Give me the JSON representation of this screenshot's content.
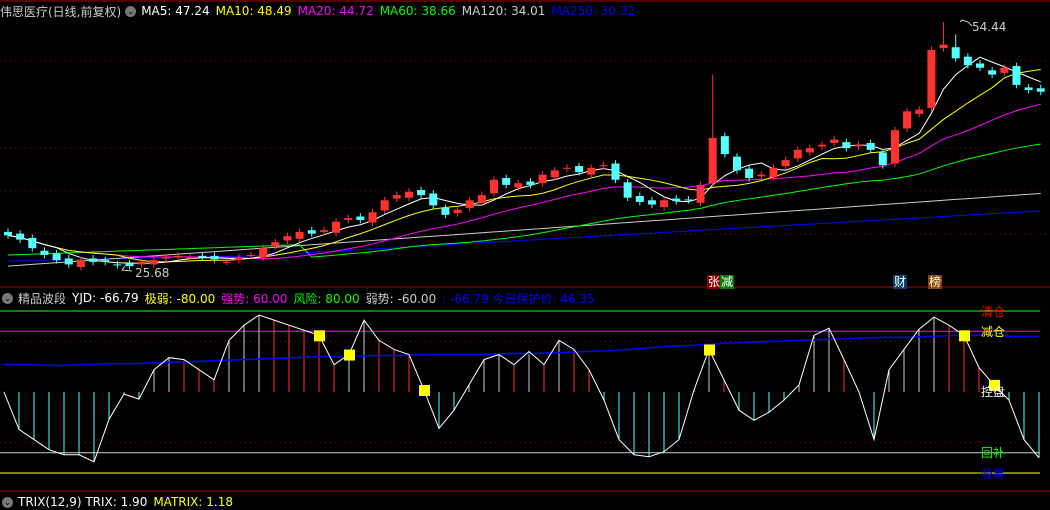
{
  "header": {
    "title": "伟思医疗(日线,前复权)",
    "ma": [
      {
        "label": "MA5: 47.24",
        "color": "#ffffff"
      },
      {
        "label": "MA10: 48.49",
        "color": "#ffff00"
      },
      {
        "label": "MA20: 44.72",
        "color": "#ff00ff"
      },
      {
        "label": "MA60: 38.66",
        "color": "#00ff00"
      },
      {
        "label": "MA120: 34.01",
        "color": "#cccccc"
      },
      {
        "label": "MA250: 30.32",
        "color": "#0000ff"
      }
    ]
  },
  "price": {
    "high_label": "54.44",
    "low_label": "25.68",
    "high": 54.44,
    "low": 25.68,
    "closes": [
      29.5,
      29.0,
      28.0,
      27.2,
      26.6,
      26.1,
      26.6,
      26.4,
      26.4,
      26.0,
      25.9,
      26.4,
      26.6,
      26.9,
      27.1,
      26.9,
      26.9,
      26.7,
      26.4,
      26.9,
      27.2,
      28.0,
      28.7,
      29.4,
      29.9,
      29.7,
      30.1,
      31.1,
      31.5,
      31.3,
      32.2,
      33.6,
      34.2,
      34.6,
      34.2,
      33.0,
      31.9,
      32.5,
      33.6,
      34.2,
      36.0,
      35.4,
      35.6,
      35.4,
      36.6,
      37.1,
      37.4,
      36.9,
      37.4,
      37.7,
      36.0,
      33.9,
      33.4,
      33.1,
      33.6,
      33.5,
      33.6,
      35.4,
      40.9,
      39.0,
      37.1,
      36.2,
      36.6,
      37.4,
      38.3,
      39.5,
      39.7,
      40.1,
      40.7,
      39.7,
      40.1,
      39.5,
      37.7,
      41.8,
      44.0,
      44.2,
      51.2,
      51.8,
      50.2,
      49.4,
      49.1,
      48.3,
      49.1,
      47.1,
      46.5,
      46.3
    ],
    "spikes": {
      "58": 48.3,
      "77": 54.44,
      "78": 53.0
    }
  },
  "tags": [
    {
      "text": "张",
      "bg": "#8b0000"
    },
    {
      "text": "减",
      "bg": "#008000"
    },
    {
      "text": "财",
      "bg": "#0a3a6e"
    },
    {
      "text": "榜",
      "bg": "#8b4500"
    }
  ],
  "indicator": {
    "name": "精品波段",
    "items": [
      {
        "label": "YJD: -66.79",
        "color": "#ffffff"
      },
      {
        "label": "极弱: -80.00",
        "color": "#ffff00"
      },
      {
        "label": "强势: 60.00",
        "color": "#ff00ff"
      },
      {
        "label": "风险: 80.00",
        "color": "#00ff00"
      },
      {
        "label": "弱势: -60.00",
        "color": "#cccccc"
      },
      {
        "label": ": -66.79  今日保护价: 46.35",
        "color": "#0000ff"
      }
    ],
    "levels": {
      "qingcang": "清仓",
      "jiancang": "减仓",
      "kongpan": "控盘",
      "huibu": "回补",
      "xichou": "吸筹"
    },
    "yjd": [
      0,
      -37,
      -47,
      -57,
      -62,
      -62,
      -69,
      -27,
      -2,
      -7,
      22,
      34,
      32,
      22,
      12,
      51,
      66,
      76,
      71,
      66,
      61,
      56,
      27,
      37,
      71,
      51,
      42,
      37,
      2,
      -36,
      -18,
      7,
      32,
      37,
      27,
      40,
      27,
      51,
      42,
      22,
      -8,
      -47,
      -62,
      -64,
      -59,
      -47,
      2,
      42,
      12,
      -18,
      -28,
      -20,
      -8,
      7,
      56,
      63,
      32,
      0,
      -47,
      22,
      42,
      62,
      74,
      66,
      56,
      24,
      7,
      -8,
      -47,
      -65
    ],
    "guard": [
      27,
      27,
      26,
      27,
      28,
      28,
      29,
      30,
      31,
      32,
      33,
      34,
      35,
      35,
      36,
      36,
      37,
      37,
      37,
      38,
      38,
      39,
      40,
      41,
      43,
      45,
      46,
      48,
      49,
      50,
      51,
      52,
      53,
      54,
      54,
      55,
      56,
      56,
      55,
      55
    ],
    "signals": [
      21,
      23,
      28,
      47,
      64,
      66
    ]
  },
  "bottom": {
    "items": [
      {
        "label": "TRIX(12,9)  TRIX: 1.90",
        "color": "#ffffff"
      },
      {
        "label": "MATRIX: 1.18",
        "color": "#ffff00"
      }
    ]
  }
}
